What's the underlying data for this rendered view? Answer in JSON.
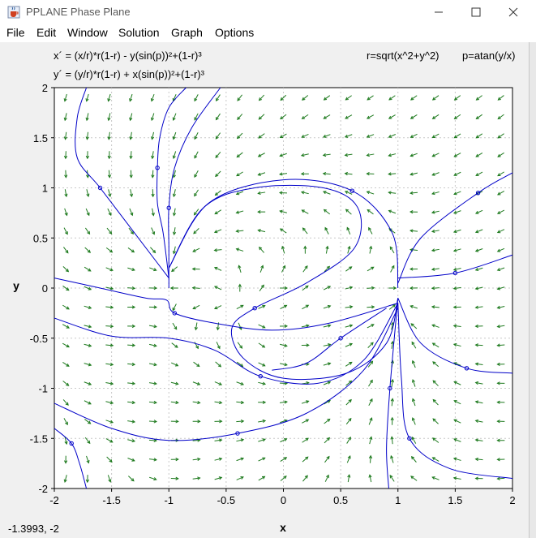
{
  "window": {
    "title": "PPLANE Phase Plane",
    "icon": "java-cup-icon",
    "controls": [
      "minimize-icon",
      "maximize-icon",
      "close-icon"
    ]
  },
  "menu": {
    "items": [
      "File",
      "Edit",
      "Window",
      "Solution",
      "Graph",
      "Options"
    ]
  },
  "equations": {
    "xprime": "x´ = (x/r)*r(1-r) - y(sin(p))²+(1-r)³",
    "yprime": "y´ = (y/r)*r(1-r) + x(sin(p))²+(1-r)³",
    "r_def": "r=sqrt(x^2+y^2)",
    "p_def": "p=atan(y/x)"
  },
  "status": {
    "cursor": "-1.3993,  -2"
  },
  "colors": {
    "field_arrow": "#1e7a1e",
    "orbit": "#0000c8",
    "grid": "#c8c8c8"
  },
  "chart_data": {
    "type": "phase-plane",
    "xlabel": "x",
    "ylabel": "y",
    "xlim": [
      -2,
      2
    ],
    "ylim": [
      -2,
      2
    ],
    "x_ticks": [
      "-2",
      "-1.5",
      "-1",
      "-0.5",
      "0",
      "0.5",
      "1",
      "1.5",
      "2"
    ],
    "y_ticks": [
      "2",
      "1.5",
      "1",
      "0.5",
      "0",
      "-0.5",
      "-1",
      "-1.5",
      "-2"
    ],
    "grid": true,
    "field_arrows": "direction field of the system over the window",
    "orbits": [
      {
        "points": [
          [
            -1.72,
            2
          ],
          [
            -1.8,
            1.7
          ],
          [
            -1.8,
            1.3
          ],
          [
            -1.6,
            1.0
          ],
          [
            -1.3,
            0.55
          ],
          [
            -1.1,
            0.25
          ],
          [
            -1.0,
            0.1
          ]
        ]
      },
      {
        "points": [
          [
            -0.85,
            2
          ],
          [
            -1.0,
            1.8
          ],
          [
            -1.08,
            1.5
          ],
          [
            -1.1,
            1.2
          ],
          [
            -1.1,
            0.85
          ],
          [
            -1.05,
            0.55
          ],
          [
            -1.0,
            0.1
          ]
        ]
      },
      {
        "points": [
          [
            -0.55,
            2
          ],
          [
            -0.8,
            1.6
          ],
          [
            -0.95,
            1.2
          ],
          [
            -1.0,
            0.8
          ],
          [
            -1.0,
            0.4
          ],
          [
            -1.0,
            0.0
          ]
        ]
      },
      {
        "points": [
          [
            -2,
            0.1
          ],
          [
            -1.6,
            0.0
          ],
          [
            -1.2,
            -0.1
          ],
          [
            -1.02,
            -0.12
          ],
          [
            -0.95,
            -0.25
          ],
          [
            -0.6,
            -0.35
          ],
          [
            -0.1,
            -0.42
          ],
          [
            0.4,
            -0.35
          ],
          [
            1.0,
            -0.15
          ]
        ]
      },
      {
        "points": [
          [
            -2,
            -0.3
          ],
          [
            -1.5,
            -0.48
          ],
          [
            -1.0,
            -0.5
          ],
          [
            -0.6,
            -0.62
          ],
          [
            -0.2,
            -0.88
          ],
          [
            0.3,
            -0.95
          ],
          [
            0.7,
            -0.72
          ],
          [
            1.0,
            -0.15
          ]
        ]
      },
      {
        "points": [
          [
            -2,
            -1.15
          ],
          [
            -1.5,
            -1.4
          ],
          [
            -1.0,
            -1.52
          ],
          [
            -0.4,
            -1.45
          ],
          [
            0.2,
            -1.25
          ],
          [
            0.7,
            -0.82
          ],
          [
            1.0,
            -0.2
          ]
        ]
      },
      {
        "points": [
          [
            -1.72,
            -2
          ],
          [
            -1.78,
            -1.75
          ],
          [
            -1.85,
            -1.55
          ],
          [
            -2,
            -1.4
          ]
        ]
      },
      {
        "points": [
          [
            -1.0,
            0.2
          ],
          [
            -0.7,
            0.8
          ],
          [
            -0.25,
            1.0
          ],
          [
            0.35,
            1.0
          ],
          [
            0.65,
            0.8
          ],
          [
            0.62,
            0.4
          ],
          [
            0.2,
            0.05
          ],
          [
            -0.25,
            -0.2
          ],
          [
            -0.45,
            -0.4
          ],
          [
            -0.35,
            -0.7
          ],
          [
            0.0,
            -0.9
          ],
          [
            0.55,
            -0.85
          ],
          [
            0.9,
            -0.55
          ],
          [
            1.0,
            -0.1
          ]
        ]
      },
      {
        "points": [
          [
            -1.0,
            0.2
          ],
          [
            -0.65,
            0.85
          ],
          [
            0.0,
            1.08
          ],
          [
            0.6,
            0.97
          ],
          [
            0.95,
            0.55
          ],
          [
            1.0,
            0.0
          ]
        ]
      },
      {
        "points": [
          [
            1.0,
            0.1
          ],
          [
            1.5,
            0.15
          ],
          [
            2,
            0.33
          ]
        ]
      },
      {
        "points": [
          [
            1.0,
            0.05
          ],
          [
            1.2,
            0.5
          ],
          [
            1.7,
            0.95
          ],
          [
            2,
            1.15
          ]
        ]
      },
      {
        "points": [
          [
            0.92,
            -2
          ],
          [
            0.9,
            -1.6
          ],
          [
            0.93,
            -1.0
          ],
          [
            1.0,
            -0.1
          ]
        ]
      },
      {
        "points": [
          [
            1.0,
            -0.15
          ],
          [
            1.03,
            -0.9
          ],
          [
            1.1,
            -1.5
          ],
          [
            1.45,
            -1.8
          ],
          [
            2,
            -1.9
          ]
        ]
      },
      {
        "points": [
          [
            1.0,
            -0.1
          ],
          [
            1.2,
            -0.55
          ],
          [
            1.6,
            -0.8
          ],
          [
            2,
            -0.85
          ]
        ]
      },
      {
        "points": [
          [
            -0.1,
            -0.82
          ],
          [
            0.2,
            -0.75
          ],
          [
            0.5,
            -0.5
          ],
          [
            0.9,
            -0.2
          ]
        ]
      }
    ]
  }
}
